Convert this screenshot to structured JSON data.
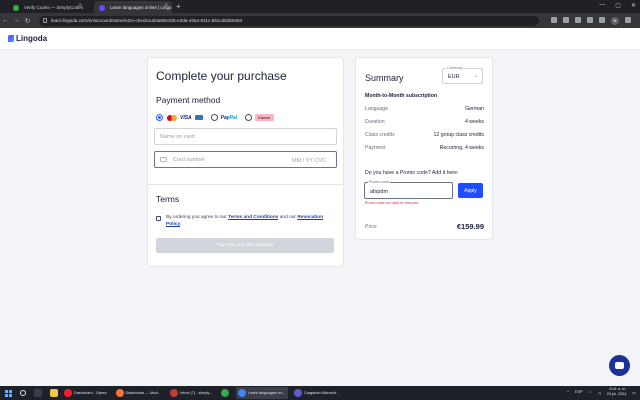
{
  "browser": {
    "tabs": [
      {
        "title": "Verify Codes — SimplyCodes",
        "active": false,
        "favicon_color": "#2fb344"
      },
      {
        "title": "Learn languages online | Lingo",
        "active": true,
        "favicon_color": "#6a4cff"
      }
    ],
    "new_tab": "+",
    "url": "learn.lingoda.com/en/account/store/m2m-checkout/da80e325-e2da-40a4-911c-b51c462b9464",
    "profile_initial": "N"
  },
  "site": {
    "logo_text": "Lingoda"
  },
  "checkout": {
    "title": "Complete your purchase",
    "payment_method_heading": "Payment method",
    "methods": {
      "card_selected": true,
      "visa_label": "VISA",
      "paypal_label_a": "Pay",
      "paypal_label_b": "Pal",
      "klarna_label": "Klarna."
    },
    "name_placeholder": "Name on card",
    "card_placeholder": "Card number",
    "card_expiry_cvc_placeholder": "MM / YY  CVC",
    "terms_heading": "Terms",
    "terms_text_1": "By ordering you agree to our ",
    "terms_link_1": "Terms and Conditions",
    "terms_text_2": " and our ",
    "terms_link_2": "Revocation Policy",
    "terms_text_3": ".",
    "pay_button": "Pay now and start learning"
  },
  "summary": {
    "title": "Summary",
    "currency_label": "Currency",
    "currency_value": "EUR",
    "subscription_heading": "Month-to-Month subscription",
    "rows": [
      {
        "label": "Language",
        "value": "German"
      },
      {
        "label": "Duration",
        "value": "4 weeks"
      },
      {
        "label": "Class credits",
        "value": "12 group class credits"
      },
      {
        "label": "Payment",
        "value": "Recurring, 4 weeks"
      }
    ],
    "promo_question": "Do you have a Promo code? Add it here:",
    "promo_label": "Promo code",
    "promo_value": "afspdm",
    "apply_button": "Apply",
    "promo_error": "Promo code not valid for this plan",
    "price_label": "Price",
    "price_value": "€159.99"
  },
  "taskbar": {
    "apps": [
      {
        "label": "Dashboard - Opera",
        "color": "#ff1b2d",
        "active": false
      },
      {
        "label": "Dashboard — Mozi...",
        "color": "#ff7139",
        "active": false
      },
      {
        "label": "Inbox (7) - simply...",
        "color": "#c23b3b",
        "active": false
      },
      {
        "label": "",
        "color": "#34a853",
        "active": false
      },
      {
        "label": "Learn languages on...",
        "color": "#4285f4",
        "active": true
      },
      {
        "label": "Cargando Microsof...",
        "color": "#5b5fc7",
        "active": false
      }
    ],
    "lang": "ESP",
    "time": "8:41 a. m.",
    "date": "23 jul. 2024"
  }
}
